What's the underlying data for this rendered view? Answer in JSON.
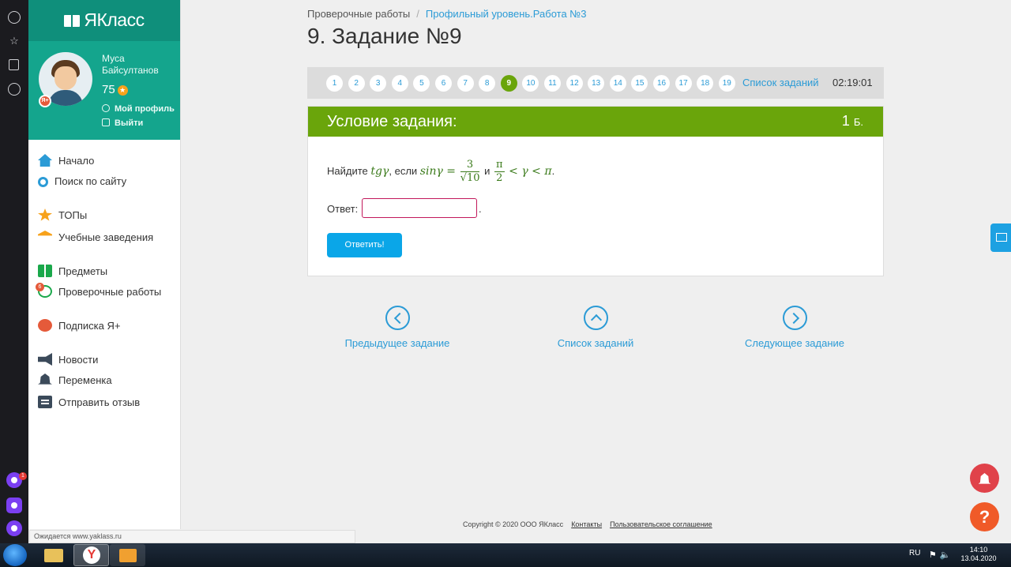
{
  "brand": {
    "name": "ЯКласс"
  },
  "profile": {
    "name": "Муса Байсултанов",
    "points": "75",
    "plus_badge": "Я+",
    "my_profile": "Мой профиль",
    "logout": "Выйти"
  },
  "nav": {
    "home": "Начало",
    "search": "Поиск по сайту",
    "tops": "ТОПы",
    "schools": "Учебные заведения",
    "subjects": "Предметы",
    "tests": "Проверочные работы",
    "tests_badge": "6",
    "subscription": "Подписка Я+",
    "news": "Новости",
    "break": "Переменка",
    "feedback": "Отправить отзыв"
  },
  "breadcrumb": {
    "parent": "Проверочные работы",
    "current": "Профильный уровень.Работа №3"
  },
  "page_title": "9. Задание №9",
  "pager": {
    "pages": [
      "1",
      "2",
      "3",
      "4",
      "5",
      "6",
      "7",
      "8",
      "9",
      "10",
      "11",
      "12",
      "13",
      "14",
      "15",
      "16",
      "17",
      "18",
      "19"
    ],
    "active": "9",
    "list_label": "Список заданий",
    "timer": "02:19:01"
  },
  "task": {
    "header": "Условие задания:",
    "points_value": "1",
    "points_unit": "Б.",
    "q_prefix": "Найдите",
    "q_tg": "tgγ",
    "q_mid": ", если",
    "q_sin": "sinγ =",
    "frac1_num": "3",
    "frac1_den": "√10",
    "q_and": "и",
    "frac2_num": "π",
    "frac2_den": "2",
    "q_ineq": "< γ < π",
    "q_end": ".",
    "answer_label": "Ответ:",
    "answer_value": "",
    "answer_dot": ".",
    "submit_label": "Ответить!"
  },
  "bottom_nav": {
    "prev": "Предыдущее задание",
    "list": "Список заданий",
    "next": "Следующее задание"
  },
  "footer": {
    "copyright": "Copyright © 2020 ООО ЯКласс",
    "contacts": "Контакты",
    "agreement": "Пользовательское соглашение"
  },
  "status_bar": "Ожидается www.yaklass.ru",
  "taskbar": {
    "lang": "RU",
    "time": "14:10",
    "date": "13.04.2020"
  },
  "fab": {
    "help": "?"
  },
  "colors": {
    "brand_green": "#14a58d",
    "task_green": "#6aa50b",
    "link_blue": "#2b9bd6",
    "button_blue": "#0aa6e8"
  }
}
